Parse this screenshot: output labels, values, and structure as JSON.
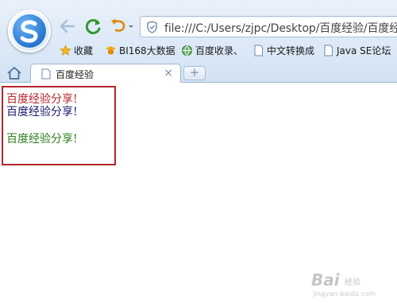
{
  "address_bar": {
    "url": "file:///C:/Users/zjpc/Desktop/百度经验/百度经"
  },
  "bookmarks": [
    {
      "label": "收藏",
      "icon": "star-icon"
    },
    {
      "label": "BI168大数据",
      "icon": "hat-icon"
    },
    {
      "label": "百度收录、",
      "icon": "globe-icon"
    },
    {
      "label": "中文转换成",
      "icon": "page-icon"
    },
    {
      "label": "Java SE论坛",
      "icon": "page-icon"
    }
  ],
  "tab": {
    "title": "百度经验",
    "close": "×"
  },
  "new_tab": "+",
  "content": {
    "lines": [
      {
        "text": "百度经验分享!",
        "color": "#b4262a"
      },
      {
        "text": "百度经验分享!",
        "color": "#1a1a6e"
      },
      {
        "text": "百度经验分享!",
        "color": "#2e7d1f"
      }
    ],
    "box_color": "#b4262a"
  },
  "watermark": {
    "logo": "Bai",
    "sub": "经验",
    "url": "jingyan.baidu.com"
  }
}
